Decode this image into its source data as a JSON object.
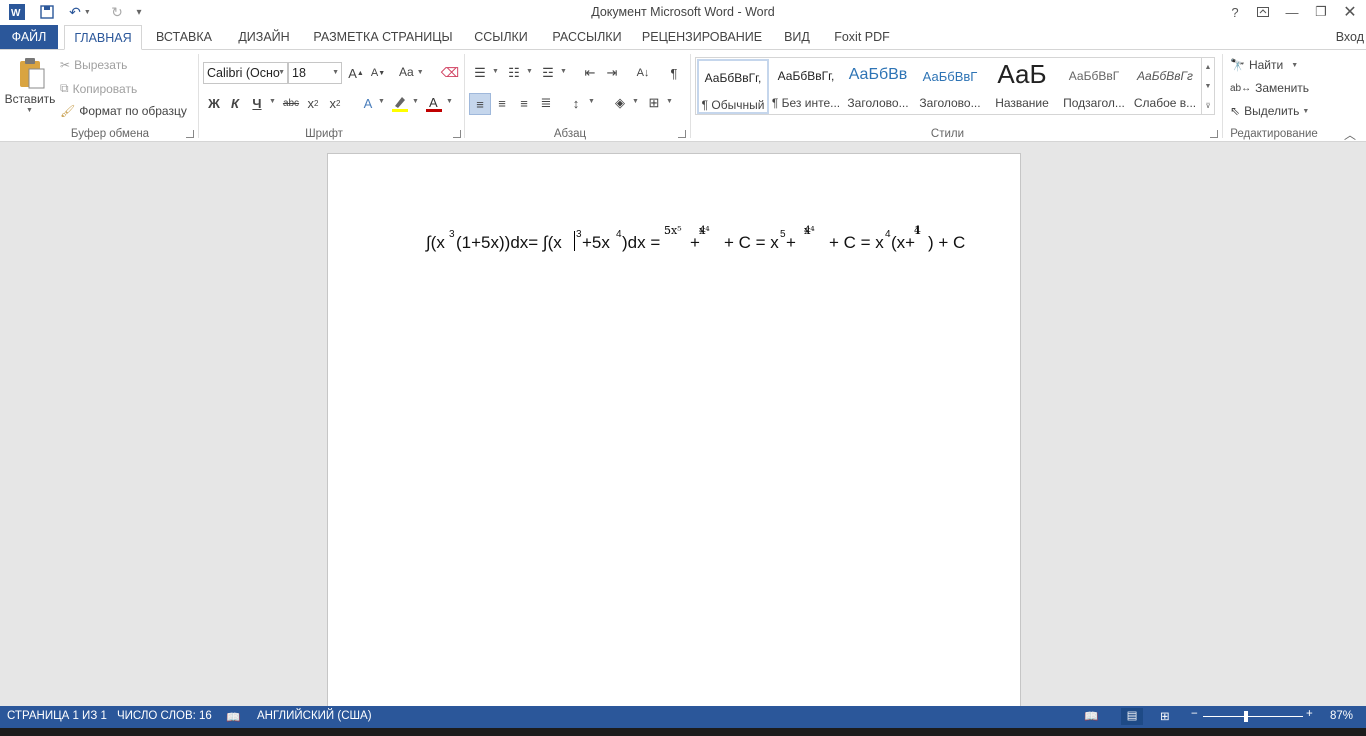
{
  "window": {
    "title": "Документ Microsoft Word - Word",
    "help": "?",
    "login": "Вход"
  },
  "tabs": [
    "ФАЙЛ",
    "ГЛАВНАЯ",
    "ВСТАВКА",
    "ДИЗАЙН",
    "РАЗМЕТКА СТРАНИЦЫ",
    "ССЫЛКИ",
    "РАССЫЛКИ",
    "РЕЦЕНЗИРОВАНИЕ",
    "ВИД",
    "Foxit PDF"
  ],
  "clipboard": {
    "paste": "Вставить",
    "cut": "Вырезать",
    "copy": "Копировать",
    "format_painter": "Формат по образцу",
    "label": "Буфер обмена"
  },
  "font": {
    "name": "Calibri (Осно",
    "size": "18",
    "label": "Шрифт",
    "bold": "Ж",
    "italic": "К",
    "underline": "Ч",
    "strike": "abc",
    "change_case": "Aa"
  },
  "paragraph": {
    "label": "Абзац"
  },
  "styles": {
    "label": "Стили",
    "items": [
      {
        "preview": "АаБбВвГг,",
        "name": "¶ Обычный"
      },
      {
        "preview": "АаБбВвГг,",
        "name": "¶ Без инте..."
      },
      {
        "preview": "АаБбВв",
        "name": "Заголово..."
      },
      {
        "preview": "АаБбВвГ",
        "name": "Заголово..."
      },
      {
        "preview": "АаБ",
        "name": "Название"
      },
      {
        "preview": "АаБбВвГ",
        "name": "Подзагол..."
      },
      {
        "preview": "АаБбВвГг",
        "name": "Слабое в..."
      }
    ]
  },
  "editing": {
    "find": "Найти",
    "replace": "Заменить",
    "select": "Выделить",
    "label": "Редактирование"
  },
  "document": {
    "equation": {
      "t1": "∫(x",
      "t2": "3",
      "t3": "(1+5x))dx= ∫(x",
      "t4": "3",
      "t5": "+5x",
      "t6": "4",
      "t7": ")dx = ",
      "f1n": "5x⁵",
      "f1d": "5",
      "t8": "+",
      "f2n": "x⁴",
      "f2d": "4",
      "t9": "+ C = x",
      "t10": "5",
      "t11": " + ",
      "f3n": "x⁴",
      "f3d": "4",
      "t12": "+ C = x",
      "t13": "4",
      "t14": "(x+",
      "f4n": "1",
      "f4d": "4",
      "t15": ") + C"
    }
  },
  "statusbar": {
    "page": "СТРАНИЦА 1 ИЗ 1",
    "words": "ЧИСЛО СЛОВ: 16",
    "language": "АНГЛИЙСКИЙ (США)",
    "zoom": "87%",
    "zoom_level": 0.87
  },
  "colors": {
    "accent": "#2b579a",
    "font_color": "#c00000",
    "highlight": "#ffff00"
  }
}
